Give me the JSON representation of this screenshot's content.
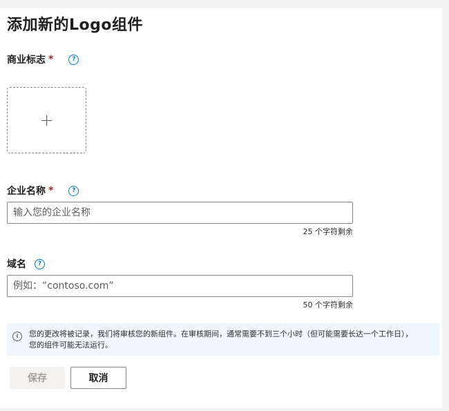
{
  "page": {
    "title": "添加新的Logo组件"
  },
  "logo_field": {
    "label": "商业标志",
    "required_mark": "*",
    "help_icon": "question-circle-icon",
    "help_glyph": "?",
    "upload_icon": "plus-icon",
    "upload_glyph": "+"
  },
  "company_field": {
    "label": "企业名称",
    "required_mark": "*",
    "help_glyph": "?",
    "placeholder": "输入您的企业名称",
    "value": "",
    "counter": "25 个字符剩余"
  },
  "domain_field": {
    "label": "域名",
    "help_glyph": "?",
    "placeholder": "例如：“contoso.com”",
    "value": "",
    "counter": "50 个字符剩余"
  },
  "info_banner": {
    "icon": "info-circle-icon",
    "glyph": "i",
    "text": "您的更改将被记录，我们将审核您的新组件。在审核期间，通常需要不到三个小时（但可能需要长达一个工作日），您的组件可能无法运行。"
  },
  "actions": {
    "save_label": "保存",
    "save_enabled": false,
    "cancel_label": "取消"
  },
  "colors": {
    "accent": "#0078d4",
    "required": "#a4262c",
    "info_background": "#eff6fc"
  }
}
